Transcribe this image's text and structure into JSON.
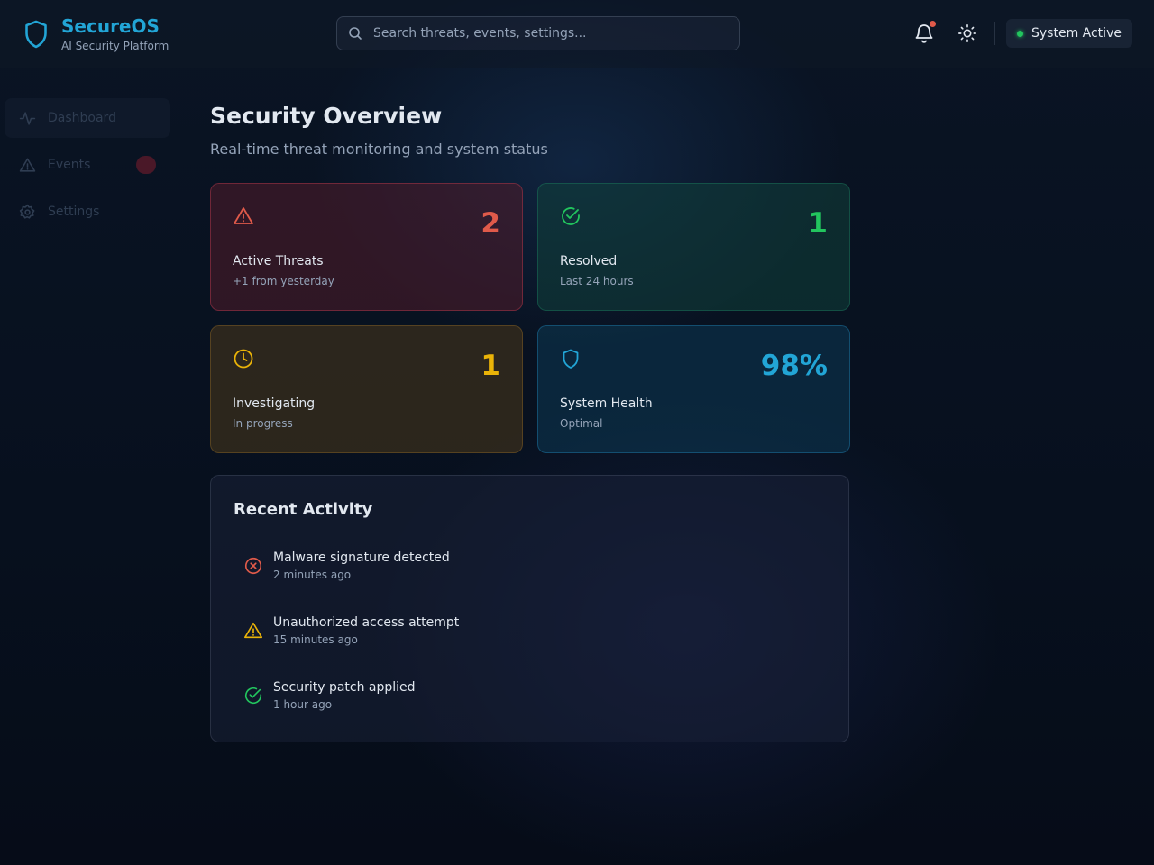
{
  "brand": {
    "title": "SecureOS",
    "subtitle": "AI Security Platform",
    "icon": "shield-icon"
  },
  "search": {
    "placeholder": "Search threats, events, settings...",
    "value": ""
  },
  "header": {
    "notifications_icon": "bell-icon",
    "theme_icon": "sun-icon",
    "status_label": "System Active",
    "status_color": "#22c55e"
  },
  "sidebar": {
    "items": [
      {
        "label": "Dashboard",
        "icon": "activity-icon",
        "active": true
      },
      {
        "label": "Events",
        "icon": "alert-triangle-icon",
        "badge": ""
      },
      {
        "label": "Settings",
        "icon": "gear-icon"
      }
    ]
  },
  "page": {
    "title": "Security Overview",
    "subtitle": "Real-time threat monitoring and system status"
  },
  "cards": [
    {
      "value": "2",
      "label": "Active Threats",
      "sub": "+1 from yesterday",
      "icon": "alert-triangle-icon",
      "color": "#e05a4a"
    },
    {
      "value": "1",
      "label": "Resolved",
      "sub": "Last 24 hours",
      "icon": "check-circle-icon",
      "color": "#22c55e"
    },
    {
      "value": "1",
      "label": "Investigating",
      "sub": "In progress",
      "icon": "clock-icon",
      "color": "#eab308"
    },
    {
      "value": "98%",
      "label": "System Health",
      "sub": "Optimal",
      "icon": "shield-icon",
      "color": "#22a5d6"
    }
  ],
  "activity": {
    "title": "Recent Activity",
    "items": [
      {
        "title": "Malware signature detected",
        "time": "2 minutes ago",
        "icon": "x-circle-icon",
        "color": "#e05a4a"
      },
      {
        "title": "Unauthorized access attempt",
        "time": "15 minutes ago",
        "icon": "alert-triangle-icon",
        "color": "#eab308"
      },
      {
        "title": "Security patch applied",
        "time": "1 hour ago",
        "icon": "check-circle-icon",
        "color": "#22c55e"
      }
    ]
  }
}
